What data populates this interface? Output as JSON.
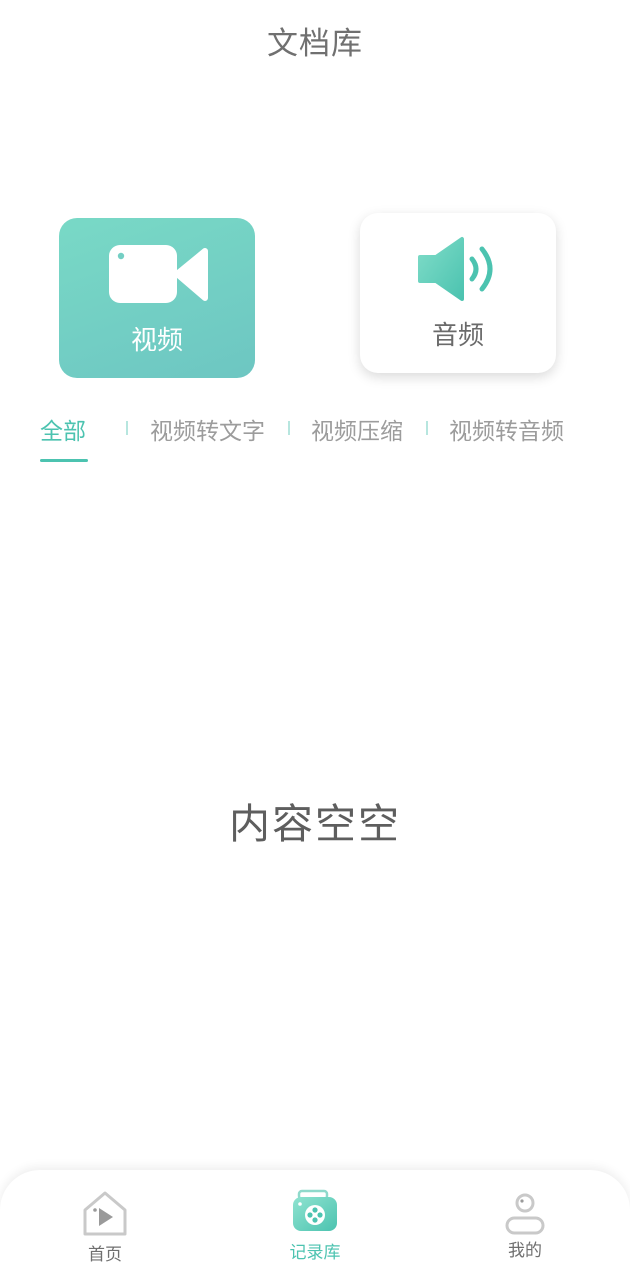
{
  "header": {
    "title": "文档库"
  },
  "type_cards": {
    "video_label": "视频",
    "audio_label": "音频"
  },
  "tabs": [
    {
      "label": "全部",
      "active": true
    },
    {
      "label": "视频转文字",
      "active": false
    },
    {
      "label": "视频压缩",
      "active": false
    },
    {
      "label": "视频转音频",
      "active": false
    }
  ],
  "empty_state": {
    "text": "内容空空"
  },
  "bottom_nav": [
    {
      "label": "首页",
      "icon": "home-play-icon",
      "active": false
    },
    {
      "label": "记录库",
      "icon": "film-reel-icon",
      "active": true
    },
    {
      "label": "我的",
      "icon": "person-icon",
      "active": false
    }
  ],
  "colors": {
    "accent": "#4cc3b0",
    "card_gradient_start": "#79d9c6",
    "card_gradient_end": "#6dc6c2",
    "text_gray": "#9c9c9c"
  }
}
